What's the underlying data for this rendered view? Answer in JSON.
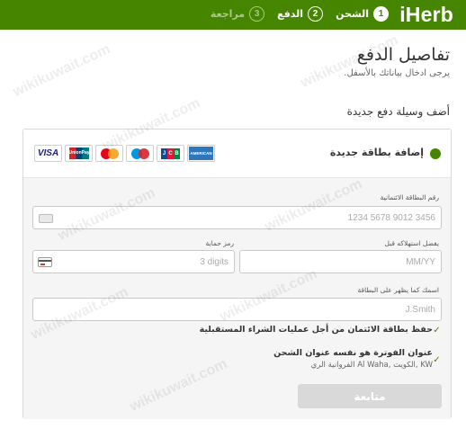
{
  "header": {
    "logo": "iHerb",
    "steps": [
      {
        "num": "1",
        "label": "الشحن",
        "state": "active"
      },
      {
        "num": "2",
        "label": "الدفع",
        "state": "pending"
      },
      {
        "num": "3",
        "label": "مراجعة",
        "state": "future"
      }
    ]
  },
  "page": {
    "title": "تفاصيل الدفع",
    "subtitle": "يرجى ادخال بياناتك بالأسفل.",
    "section_title": "أضف وسيلة دفع جديدة"
  },
  "payment_option": {
    "label": "إضافة بطاقة جديدة",
    "brands": [
      "VISA",
      "UnionPay",
      "MasterCard",
      "Maestro",
      "JCB",
      "American Express"
    ]
  },
  "form": {
    "card_number": {
      "label": "رقم البطاقة الائتمانية",
      "placeholder": "1234 5678 9012 3456"
    },
    "cvv": {
      "label": "رمز حماية",
      "placeholder": "3 digits"
    },
    "expiry": {
      "label": "يفضل استهلاكه قبل",
      "placeholder": "MM/YY"
    },
    "name": {
      "label": "اسمك كما يظهر على البطاقة",
      "placeholder": "J.Smith"
    },
    "save_card": {
      "label": "حفظ بطاقة الائتمان من أجل عمليات الشراء المستقبلية",
      "checked": true
    },
    "billing_same": {
      "label": "عنوان الفوترة هو نفسه عنوان الشحن",
      "checked": true,
      "address": "KW ,الكويت ,Al Waha الفروانية الري"
    },
    "continue_label": "متابعة"
  },
  "colors": {
    "brand_green": "#458500",
    "disabled_button": "#d9d9d9"
  },
  "watermark": "wikikuwait.com"
}
